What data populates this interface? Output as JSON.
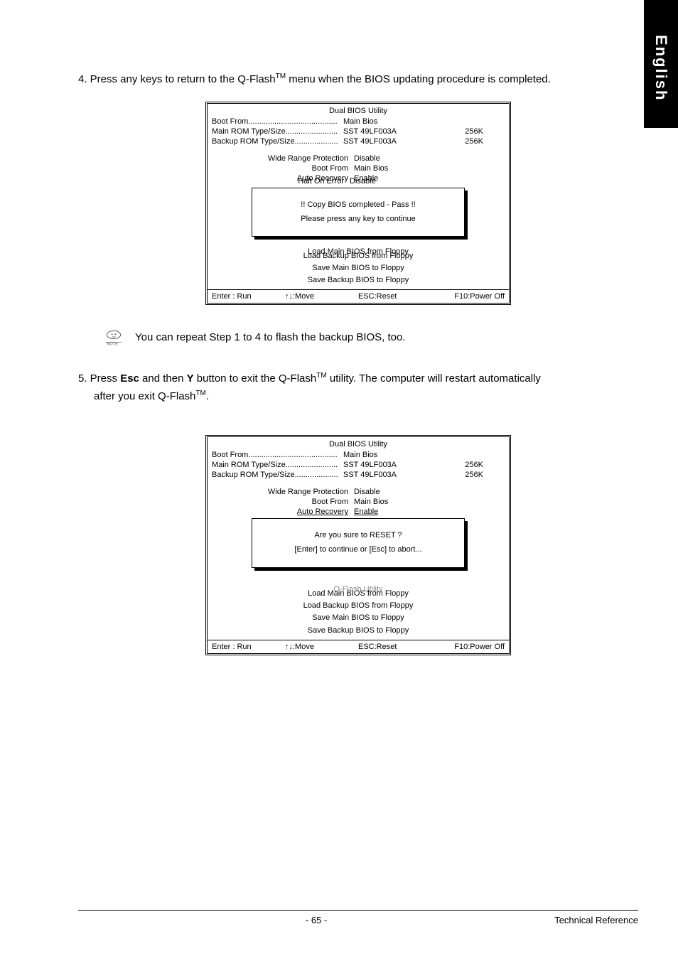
{
  "side_tab": "English",
  "step4": "4. Press any keys to return to the Q-Flash",
  "step4_tm": "TM",
  "step4_after": " menu when the BIOS updating procedure is completed.",
  "note_text": "You can repeat Step 1 to 4 to flash the backup BIOS, too.",
  "step5_a": "5. Press ",
  "step5_esc": "Esc",
  "step5_b": " and then ",
  "step5_y": "Y",
  "step5_c": " button to exit the Q-Flash",
  "step5_tm": "TM",
  "step5_d": " utility. The computer will restart automatically",
  "step5_e": "after you exit Q-Flash",
  "step5_tm2": "TM",
  "step5_f": ".",
  "bios": {
    "title": "Dual BIOS Utility",
    "bootfrom_lbl": "Boot From.........................................",
    "bootfrom_val": "Main Bios",
    "mainrom_lbl": "Main ROM Type/Size........................",
    "mainrom_val": "SST 49LF003A",
    "mainrom_size": "256K",
    "bkrom_lbl": "Backup ROM Type/Size....................",
    "bkrom_val": "SST 49LF003A",
    "bkrom_size": "256K",
    "s1_lbl": "Wide Range Protection",
    "s1_val": "Disable",
    "s2_lbl": "Boot From",
    "s2_val": "Main Bios",
    "s3_lbl": "Auto Recovery",
    "s3_val": "Enable",
    "s4_lbl": "Halt On Error",
    "s4_val": "Disable",
    "menu_hidden": "Q-Flash Utility",
    "menu1": "Load Main BIOS from Floppy",
    "menu2": "Load Backup BIOS from Floppy",
    "menu3": "Save Main BIOS to Floppy",
    "menu4": "Save Backup BIOS to Floppy",
    "f1": "Enter : Run",
    "f2": "↑↓:Move",
    "f3": "ESC:Reset",
    "f4": "F10:Power Off"
  },
  "overlay1_l1": "!! Copy BIOS completed - Pass !!",
  "overlay1_l2": "Please press any key to continue",
  "overlay2_l1": "Are you sure to RESET ?",
  "overlay2_l2": "[Enter] to continue or [Esc] to abort...",
  "page_num": "- 65 -",
  "page_section": "Technical Reference"
}
